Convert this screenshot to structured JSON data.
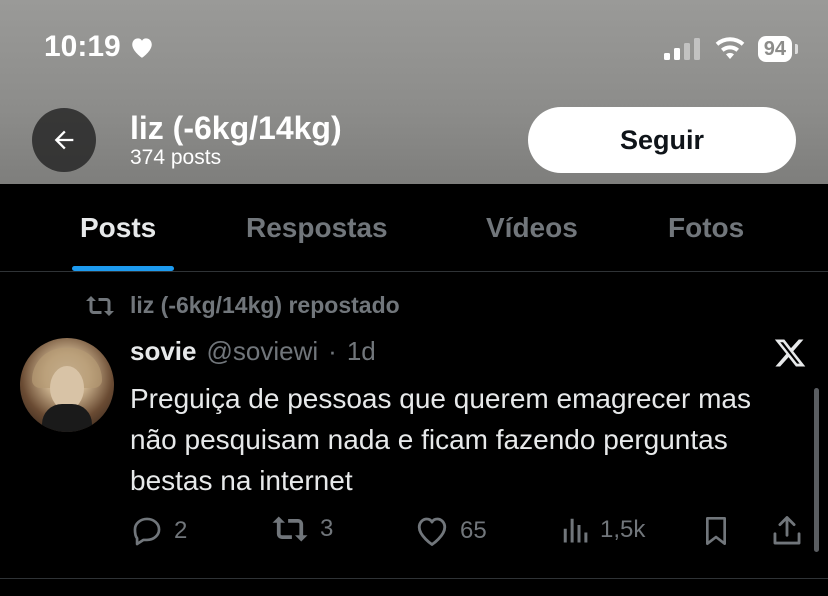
{
  "status_bar": {
    "time": "10:19",
    "battery": "94"
  },
  "header": {
    "name": "liz (-6kg/14kg)",
    "posts_count": "374 posts",
    "follow_label": "Seguir"
  },
  "tabs": [
    {
      "label": "Posts",
      "active": true
    },
    {
      "label": "Respostas",
      "active": false
    },
    {
      "label": "Vídeos",
      "active": false
    },
    {
      "label": "Fotos",
      "active": false
    }
  ],
  "post": {
    "repost_label": "liz (-6kg/14kg) repostado",
    "author_name": "sovie",
    "author_handle": "@soviewi",
    "separator": "·",
    "time": "1d",
    "text": "Preguiça de pessoas que querem emagrecer mas não pesquisam nada e ficam fazendo perguntas bestas na internet",
    "replies": "2",
    "reposts": "3",
    "likes": "65",
    "views": "1,5k"
  },
  "colors": {
    "accent": "#1d9bf0",
    "muted": "#71767b",
    "text": "#e7e9ea",
    "background": "#000000"
  },
  "icons": [
    "heart-icon",
    "signal-icon",
    "wifi-icon",
    "battery-icon",
    "back-arrow-icon",
    "repost-icon",
    "x-logo-icon",
    "reply-icon",
    "like-icon",
    "views-icon",
    "bookmark-icon",
    "share-icon"
  ]
}
